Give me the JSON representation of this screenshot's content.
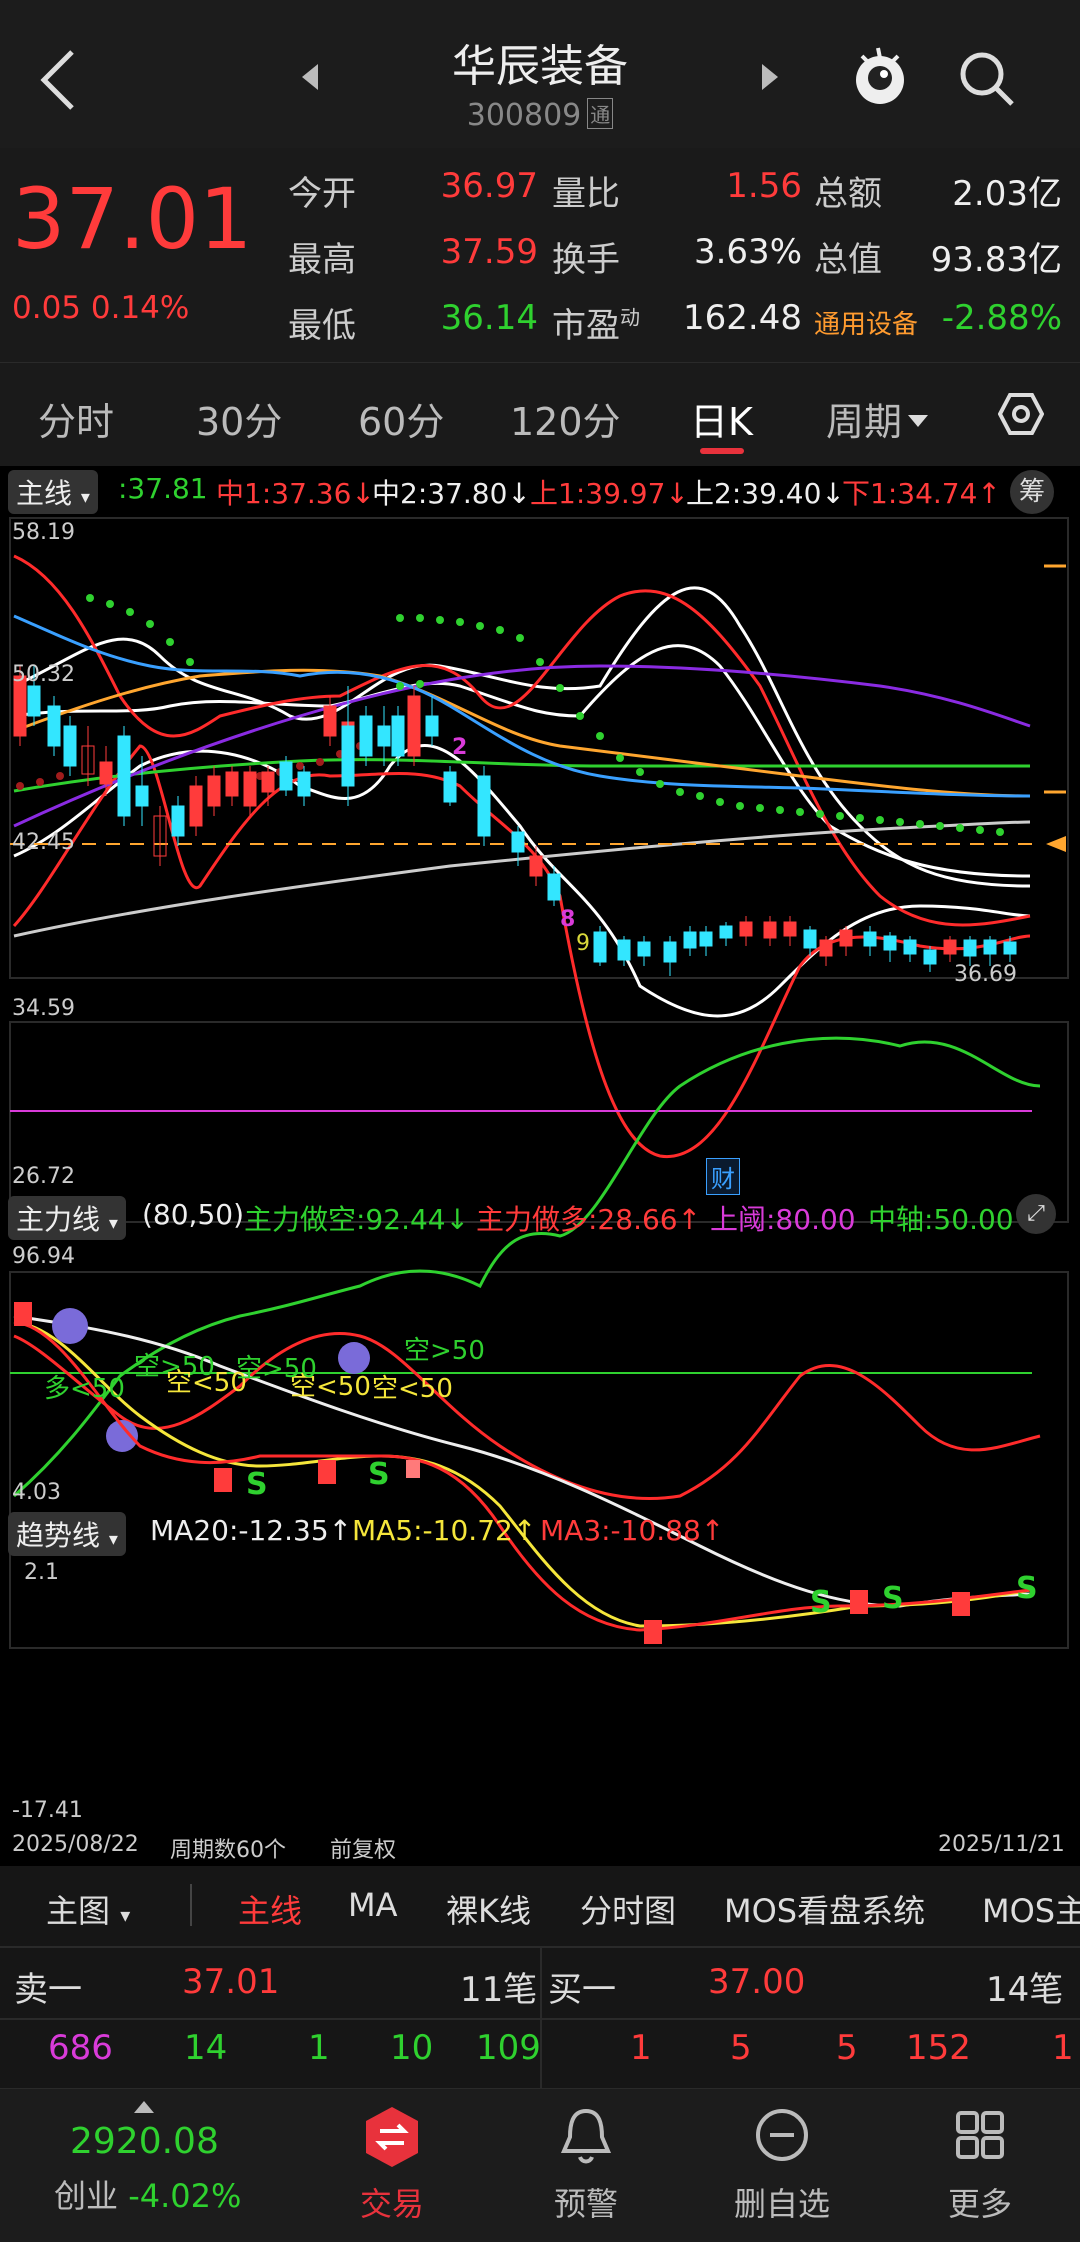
{
  "header": {
    "title": "华辰装备",
    "code": "300809",
    "code_tag": "通",
    "icons": [
      "back-arrow-icon",
      "prev-stock-icon",
      "next-stock-icon",
      "mascot-icon",
      "search-icon"
    ]
  },
  "quote": {
    "price": "37.01",
    "change": "0.05 0.14%",
    "fields": [
      {
        "label": "今开",
        "value": "36.97",
        "color": "red"
      },
      {
        "label": "最高",
        "value": "37.59",
        "color": "red"
      },
      {
        "label": "最低",
        "value": "36.14",
        "color": "green"
      },
      {
        "label": "量比",
        "value": "1.56",
        "color": "red"
      },
      {
        "label": "换手",
        "value": "3.63%",
        "color": "white"
      },
      {
        "label": "市盈",
        "label_sup": "动",
        "value": "162.48",
        "color": "white"
      },
      {
        "label": "总额",
        "value": "2.03亿",
        "color": "white"
      },
      {
        "label": "总值",
        "value": "93.83亿",
        "color": "white"
      },
      {
        "label": "通用设备",
        "value": "-2.88%",
        "color": "green"
      }
    ]
  },
  "tabs": {
    "items": [
      "分时",
      "30分",
      "60分",
      "120分",
      "日K",
      "周期"
    ],
    "active": "日K"
  },
  "main_panel": {
    "selector": "主线",
    "legend": [
      {
        "text": ":37.81",
        "color": "#2fd12f"
      },
      {
        "text": "中1:37.36↓",
        "color": "#ff3b3b"
      },
      {
        "text": "中2:37.80↓",
        "color": "#eeeeee"
      },
      {
        "text": "上1:39.97↓",
        "color": "#ff3b3b"
      },
      {
        "text": "上2:39.40↓",
        "color": "#eeeeee"
      },
      {
        "text": "下1:34.74↑",
        "color": "#ff3b3b"
      }
    ],
    "chip_button": "筹",
    "y_top": "58.19",
    "y_2": "50.32",
    "y_3": "42.45",
    "y_4": "34.59",
    "y_bottom": "26.72",
    "finance_marker": "财",
    "current_price_tag": "36.69"
  },
  "force_panel": {
    "selector": "主力线",
    "params": "(80,50)",
    "legend": [
      {
        "text": "主力做空:92.44↓",
        "color": "#2fd12f"
      },
      {
        "text": "主力做多:28.66↑",
        "color": "#ff3b3b"
      },
      {
        "text": "上阈:80.00",
        "color": "#d93bd9"
      },
      {
        "text": "中轴:50.00",
        "color": "#2fd12f"
      }
    ],
    "y_top": "96.94",
    "y_bottom": "4.03",
    "annotations": [
      "多<50",
      "空>50",
      "空<50",
      "空<50",
      "空>50",
      "空<50",
      "空>50"
    ]
  },
  "trend_panel": {
    "selector": "趋势线",
    "legend": [
      {
        "text": "MA20:-12.35↑",
        "color": "#eeeeee"
      },
      {
        "text": "MA5:-10.72↑",
        "color": "#f5e63b"
      },
      {
        "text": "MA3:-10.88↑",
        "color": "#ff3b3b"
      }
    ],
    "y_top": "2.1",
    "y_bottom": "-17.41"
  },
  "footer_axis": {
    "start_date": "2025/08/22",
    "period_count": "周期数60个",
    "adjust": "前复权",
    "end_date": "2025/11/21"
  },
  "toolbar": {
    "selector": "主图",
    "items": [
      "主线",
      "MA",
      "裸K线",
      "分时图",
      "MOS看盘系统",
      "MOS主"
    ],
    "active": "主线"
  },
  "orderbook": {
    "ask_label": "卖一",
    "ask_price": "37.01",
    "ask_count": "11笔",
    "bid_label": "买一",
    "bid_price": "37.00",
    "bid_count": "14笔",
    "ask_queue": [
      "686",
      "14",
      "1",
      "10",
      "109"
    ],
    "bid_queue": [
      "1",
      "5",
      "5",
      "152",
      "1"
    ]
  },
  "nav": {
    "index_value": "2920.08",
    "index_name": "创业",
    "index_change": "-4.02%",
    "items": [
      {
        "label": "交易",
        "icon": "trade-icon"
      },
      {
        "label": "预警",
        "icon": "bell-icon"
      },
      {
        "label": "删自选",
        "icon": "remove-watch-icon"
      },
      {
        "label": "更多",
        "icon": "grid-icon"
      }
    ]
  }
}
